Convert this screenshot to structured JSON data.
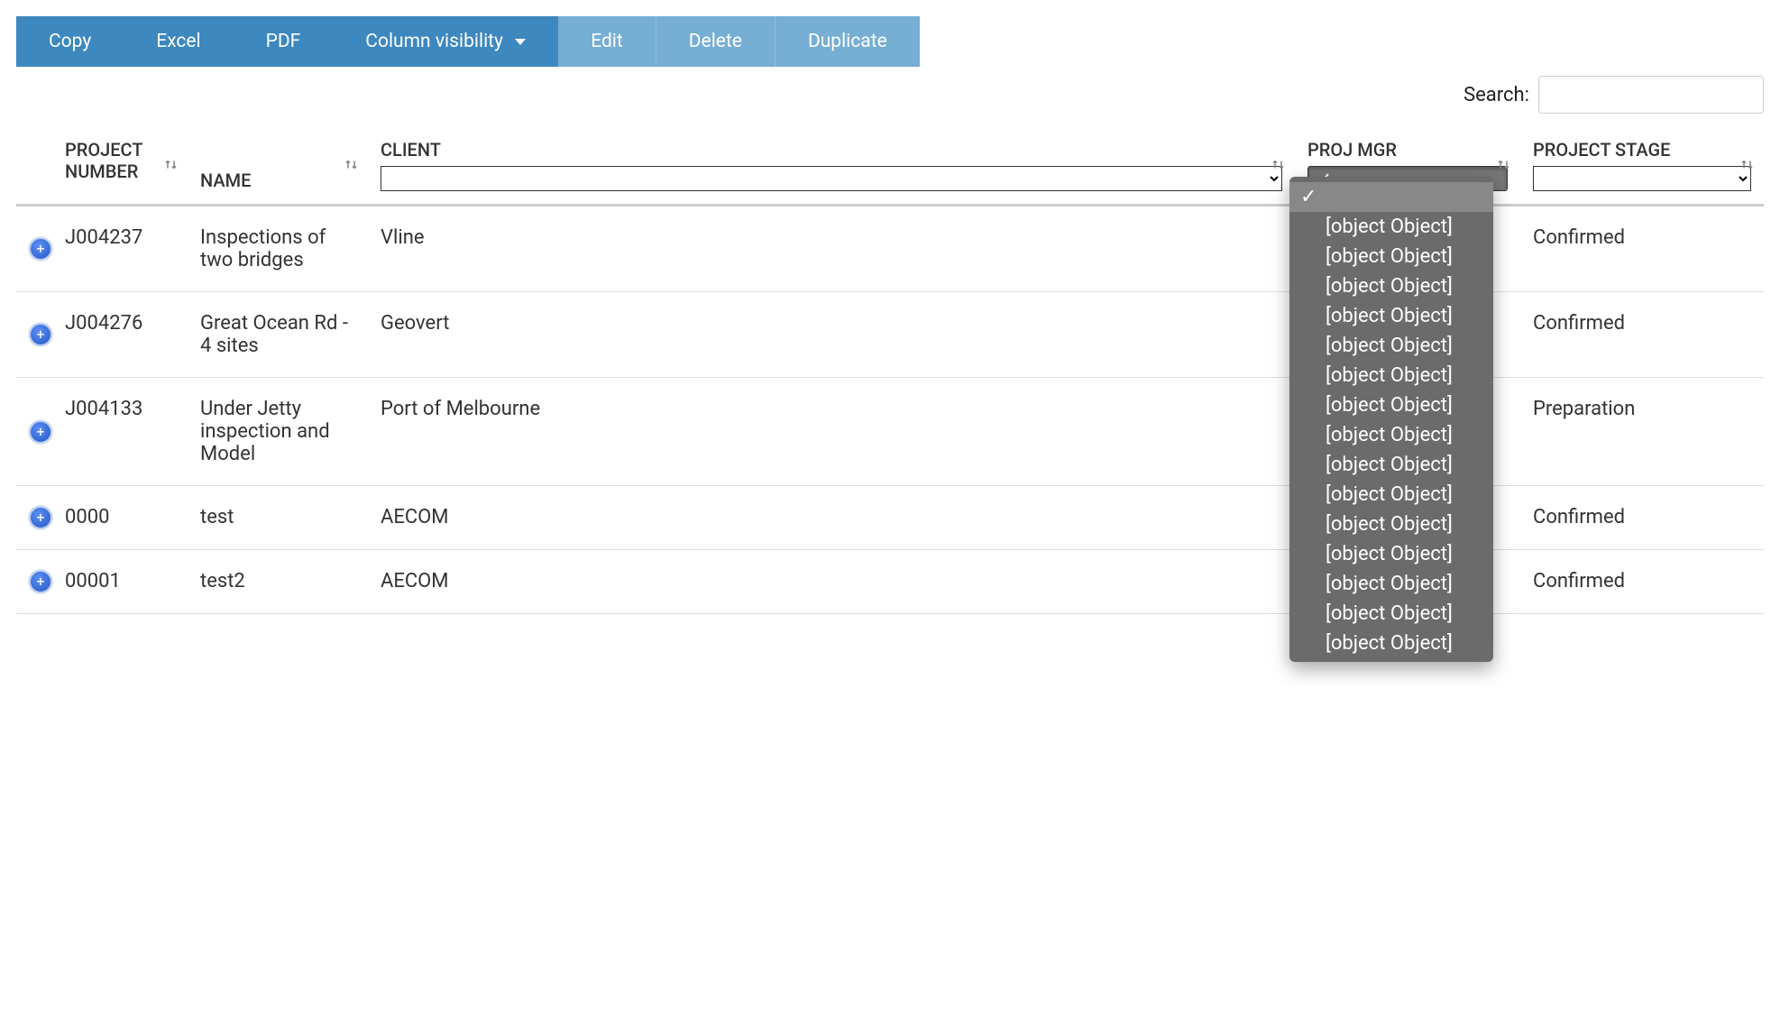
{
  "toolbar": {
    "copy": "Copy",
    "excel": "Excel",
    "pdf": "PDF",
    "colvis": "Column visibility",
    "edit": "Edit",
    "delete": "Delete",
    "duplicate": "Duplicate"
  },
  "search": {
    "label": "Search:",
    "value": ""
  },
  "columns": {
    "project_number": "PROJECT NUMBER",
    "name": "NAME",
    "client": "CLIENT",
    "proj_mgr": "PROJ MGR",
    "project_stage": "PROJECT STAGE"
  },
  "rows": [
    {
      "project_number": "J004237",
      "name": "Inspections of two bridges",
      "client": "Vline",
      "proj_mgr": "",
      "stage": "Confirmed",
      "stage_class": "stage-confirmed"
    },
    {
      "project_number": "J004276",
      "name": "Great Ocean Rd - 4 sites",
      "client": "Geovert",
      "proj_mgr": "",
      "stage": "Confirmed",
      "stage_class": "stage-confirmed"
    },
    {
      "project_number": "J004133",
      "name": "Under Jetty inspection and Model",
      "client": "Port of Melbourne",
      "proj_mgr": "",
      "stage": "Preparation",
      "stage_class": "stage-preparation"
    },
    {
      "project_number": "0000",
      "name": "test",
      "client": "AECOM",
      "proj_mgr": "",
      "stage": "Confirmed",
      "stage_class": "stage-confirmed"
    },
    {
      "project_number": "00001",
      "name": "test2",
      "client": "AECOM",
      "proj_mgr": "",
      "stage": "Confirmed",
      "stage_class": "stage-confirmed"
    }
  ],
  "proj_mgr_dropdown": {
    "selected_index": 0,
    "options": [
      "",
      "[object Object]",
      "[object Object]",
      "[object Object]",
      "[object Object]",
      "[object Object]",
      "[object Object]",
      "[object Object]",
      "[object Object]",
      "[object Object]",
      "[object Object]",
      "[object Object]",
      "[object Object]",
      "[object Object]",
      "[object Object]",
      "[object Object]"
    ]
  }
}
